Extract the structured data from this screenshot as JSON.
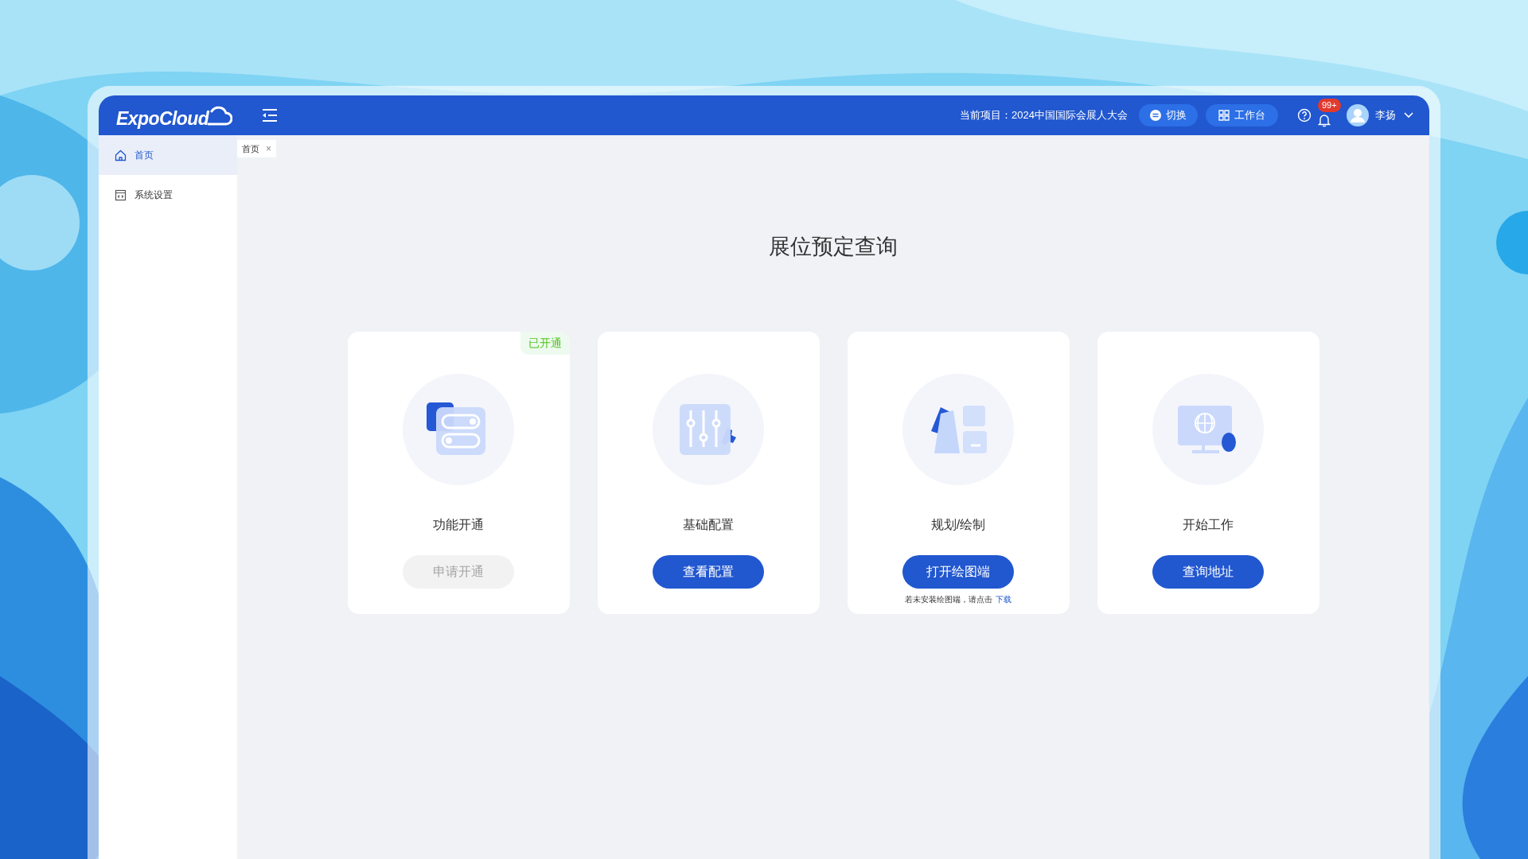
{
  "header": {
    "logo": "ExpoCloud",
    "project_label": "当前项目：2024中国国际会展人大会",
    "switch_button": "切换",
    "workbench_button": "工作台",
    "notification_count": "99+",
    "user_name": "李扬"
  },
  "sidebar": {
    "items": [
      {
        "label": "首页",
        "selected": true
      },
      {
        "label": "系统设置",
        "selected": false
      }
    ]
  },
  "tabs": [
    {
      "label": "首页",
      "close": "×",
      "selected": true
    }
  ],
  "page_title": "展位预定查询",
  "cards": [
    {
      "title": "功能开通",
      "badge": "已开通",
      "button": {
        "label": "申请开通",
        "disabled": true
      }
    },
    {
      "title": "基础配置",
      "button": {
        "label": "查看配置",
        "disabled": false
      }
    },
    {
      "title": "规划/绘制",
      "button": {
        "label": "打开绘图端",
        "disabled": false
      },
      "note": "若未安装绘图端，请点击",
      "note_link": "下载"
    },
    {
      "title": "开始工作",
      "button": {
        "label": "查询地址",
        "disabled": false
      }
    }
  ]
}
